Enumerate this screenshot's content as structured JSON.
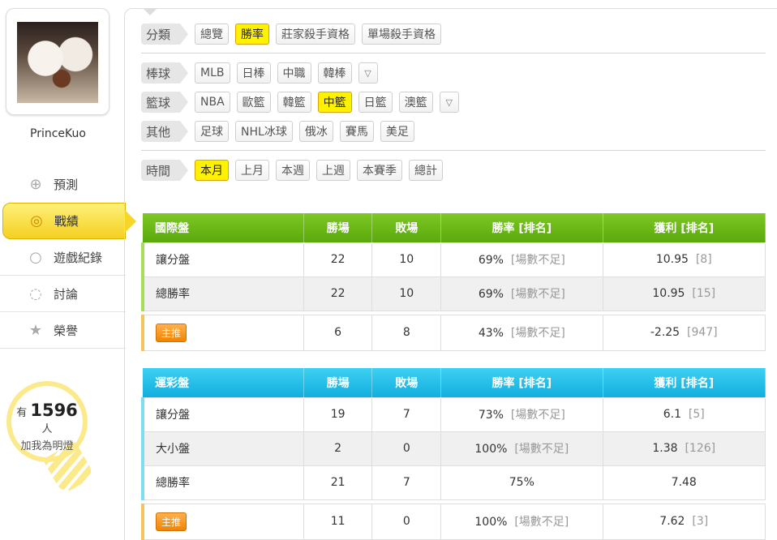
{
  "user": {
    "name": "PrinceKuo"
  },
  "nav": [
    {
      "label": "預測",
      "icon": "crosshair-icon",
      "glyph": "⊕"
    },
    {
      "label": "戰績",
      "icon": "target-icon",
      "glyph": "◎"
    },
    {
      "label": "遊戲紀錄",
      "icon": "circle-icon",
      "glyph": "○"
    },
    {
      "label": "討論",
      "icon": "chat-icon",
      "glyph": "◌"
    },
    {
      "label": "榮譽",
      "icon": "medal-icon",
      "glyph": "★"
    }
  ],
  "fans": {
    "prefix": "有",
    "count": "1596",
    "unit": "人",
    "caption": "加我為明燈"
  },
  "filters": {
    "category": {
      "label": "分類",
      "options": [
        "總覽",
        "勝率",
        "莊家殺手資格",
        "單場殺手資格"
      ],
      "selected": "勝率"
    },
    "baseball": {
      "label": "棒球",
      "options": [
        "MLB",
        "日棒",
        "中職",
        "韓棒"
      ]
    },
    "basketball": {
      "label": "籃球",
      "options": [
        "NBA",
        "歐籃",
        "韓籃",
        "中籃",
        "日籃",
        "澳籃"
      ],
      "selected": "中籃"
    },
    "others": {
      "label": "其他",
      "options": [
        "足球",
        "NHL冰球",
        "俄冰",
        "賽馬",
        "美足"
      ]
    },
    "time": {
      "label": "時間",
      "options": [
        "本月",
        "上月",
        "本週",
        "上週",
        "本賽季",
        "總計"
      ],
      "selected": "本月"
    }
  },
  "international": {
    "headers": [
      "國際盤",
      "勝場",
      "敗場",
      "勝率 [排名]",
      "獲利 [排名]"
    ],
    "rows": [
      {
        "name": "讓分盤",
        "win": "22",
        "loss": "10",
        "rate": "69%",
        "rate_rank": "[場數不足]",
        "profit": "10.95",
        "profit_rank": "[8]"
      },
      {
        "name": "總勝率",
        "win": "22",
        "loss": "10",
        "rate": "69%",
        "rate_rank": "[場數不足]",
        "profit": "10.95",
        "profit_rank": "[15]"
      }
    ],
    "featured": {
      "badge": "主推",
      "win": "6",
      "loss": "8",
      "rate": "43%",
      "rate_rank": "[場數不足]",
      "profit": "-2.25",
      "profit_rank": "[947]"
    }
  },
  "sportslottery": {
    "headers": [
      "運彩盤",
      "勝場",
      "敗場",
      "勝率 [排名]",
      "獲利 [排名]"
    ],
    "rows": [
      {
        "name": "讓分盤",
        "win": "19",
        "loss": "7",
        "rate": "73%",
        "rate_rank": "[場數不足]",
        "profit": "6.1",
        "profit_rank": "[5]"
      },
      {
        "name": "大小盤",
        "win": "2",
        "loss": "0",
        "rate": "100%",
        "rate_rank": "[場數不足]",
        "profit": "1.38",
        "profit_rank": "[126]"
      },
      {
        "name": "總勝率",
        "win": "21",
        "loss": "7",
        "rate": "75%",
        "rate_rank": "",
        "profit": "7.48",
        "profit_rank": ""
      }
    ],
    "featured": {
      "badge": "主推",
      "win": "11",
      "loss": "0",
      "rate": "100%",
      "rate_rank": "[場數不足]",
      "profit": "7.62",
      "profit_rank": "[3]"
    }
  }
}
